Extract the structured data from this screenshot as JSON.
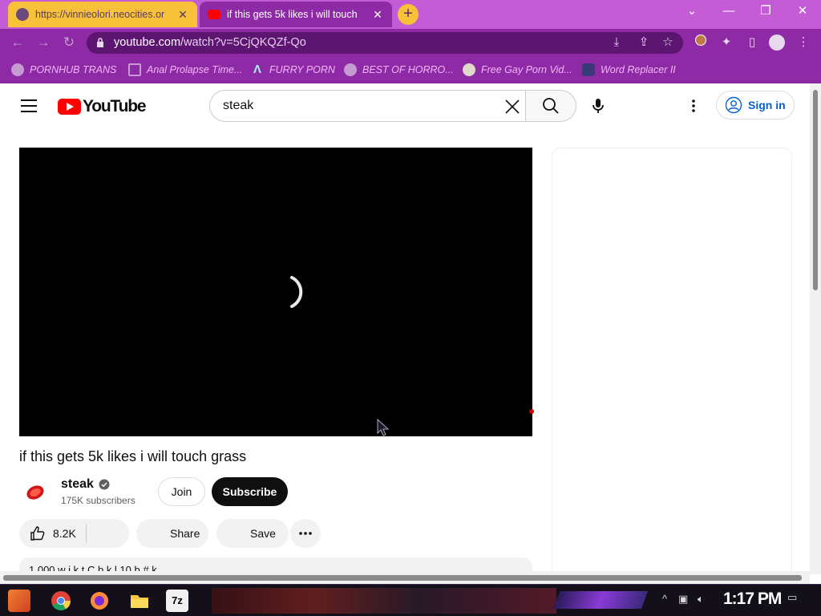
{
  "browser": {
    "tabs": [
      {
        "title": "https://vinnieolori.neocities.or",
        "active": false
      },
      {
        "title": "if this gets 5k likes i will touch",
        "active": true
      }
    ],
    "url_host": "youtube.com",
    "url_path": "/watch?v=5CjQKQZf-Qo",
    "bookmarks": [
      {
        "label": "PORNHUB TRANS"
      },
      {
        "label": "Anal Prolapse Time..."
      },
      {
        "label": "FURRY PORN"
      },
      {
        "label": "BEST OF HORRO..."
      },
      {
        "label": "Free Gay Porn Vid..."
      },
      {
        "label": "Word Replacer II"
      }
    ],
    "colors": {
      "tabbar": "#c45cd6",
      "toolbar": "#8e2aa6",
      "inactive_tab": "#f7c23a",
      "bookmark_text": "#f3b6f9"
    }
  },
  "youtube": {
    "logo_text": "YouTube",
    "search_query": "steak",
    "sign_in_label": "Sign in",
    "video": {
      "title": "if this gets 5k likes i will touch grass"
    },
    "channel": {
      "name": "steak",
      "subscribers": "175K subscribers",
      "join_label": "Join",
      "subscribe_label": "Subscribe"
    },
    "actions": {
      "likes": "8.2K",
      "share_label": "Share",
      "save_label": "Save"
    },
    "description_peek": "1,000 w  i  k  t   C  b  k  l      10   b    #  k"
  },
  "taskbar": {
    "clock": "1:17 PM",
    "apps": [
      "start-icon",
      "chrome-icon",
      "firefox-icon",
      "file-explorer-icon",
      "7zip-icon"
    ],
    "app_7z_label": "7z"
  }
}
